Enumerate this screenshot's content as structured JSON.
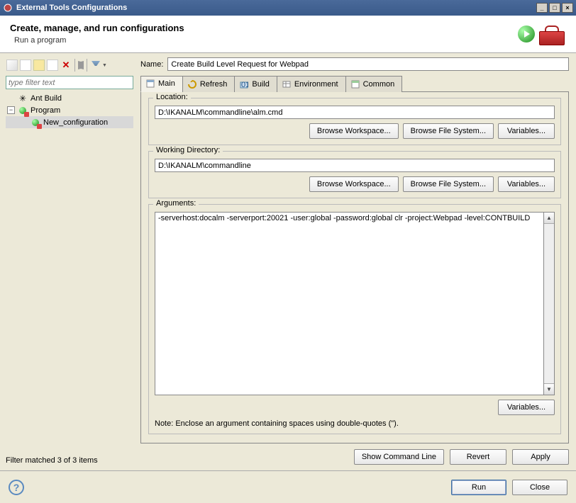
{
  "window": {
    "title": "External Tools Configurations"
  },
  "header": {
    "title": "Create, manage, and run configurations",
    "subtitle": "Run a program"
  },
  "sidebar": {
    "filter_placeholder": "type filter text",
    "items": {
      "ant": "Ant Build",
      "program": "Program",
      "newconfig": "New_configuration"
    },
    "status": "Filter matched 3 of 3 items"
  },
  "form": {
    "name_label": "Name:",
    "name_value": "Create Build Level Request for Webpad"
  },
  "tabs": {
    "main": "Main",
    "refresh": "Refresh",
    "build": "Build",
    "environment": "Environment",
    "common": "Common"
  },
  "groups": {
    "location": {
      "title": "Location:",
      "value": "D:\\IKANALM\\commandline\\alm.cmd"
    },
    "working": {
      "title": "Working Directory:",
      "value": "D:\\IKANALM\\commandline"
    },
    "arguments": {
      "title": "Arguments:",
      "value": "-serverhost:docalm -serverport:20021 -user:global -password:global clr -project:Webpad -level:CONTBUILD"
    }
  },
  "buttons": {
    "browse_ws": "Browse Workspace...",
    "browse_fs": "Browse File System...",
    "variables": "Variables...",
    "show_cmd": "Show Command Line",
    "revert": "Revert",
    "apply": "Apply",
    "run": "Run",
    "close": "Close"
  },
  "note": "Note: Enclose an argument containing spaces using double-quotes (\")."
}
